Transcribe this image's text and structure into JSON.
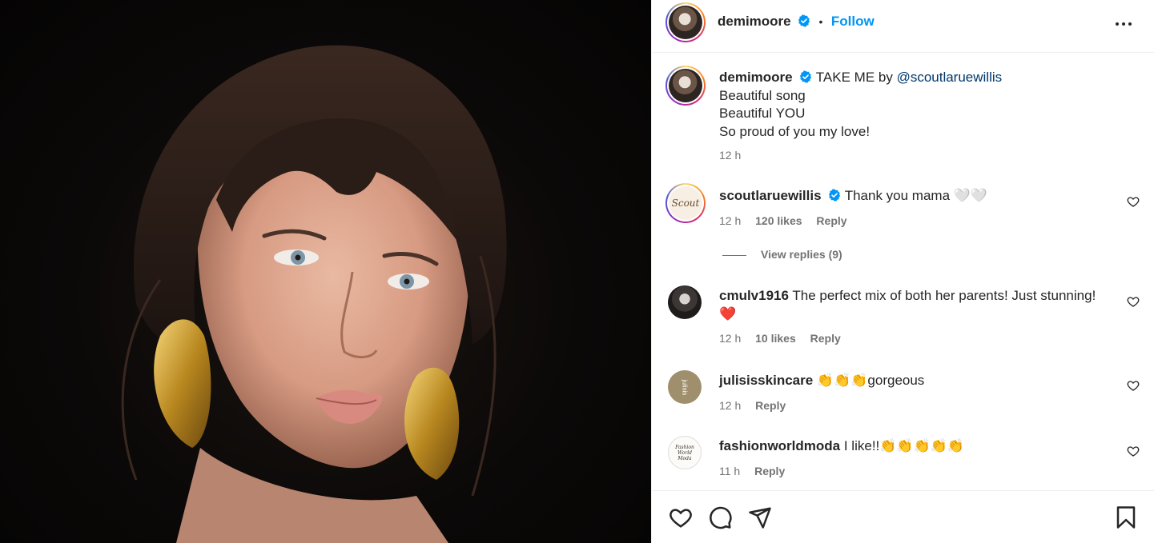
{
  "post": {
    "author": "demimoore",
    "verified": true,
    "follow_label": "Follow",
    "separator": "•"
  },
  "caption": {
    "username": "demimoore",
    "text_prefix": "TAKE ME by ",
    "mention": "@scoutlaruewillis",
    "lines": [
      "Beautiful song",
      "Beautiful YOU",
      "So proud of you my love!"
    ],
    "time": "12 h"
  },
  "comments": [
    {
      "username": "scoutlaruewillis",
      "verified": true,
      "text": "Thank you mama 🤍🤍",
      "time": "12 h",
      "likes": "120 likes",
      "reply_label": "Reply",
      "avatar_text": "Scout"
    },
    {
      "username": "cmulv1916",
      "verified": false,
      "text": "The perfect mix of both her parents! Just stunning!",
      "text_line2": "❤️",
      "time": "12 h",
      "likes": "10 likes",
      "reply_label": "Reply"
    },
    {
      "username": "julisisskincare",
      "verified": false,
      "text": "👏👏👏gorgeous",
      "time": "12 h",
      "reply_label": "Reply",
      "avatar_text": "julisis"
    },
    {
      "username": "fashionworldmoda",
      "verified": false,
      "text": "I like!!👏👏👏👏👏",
      "time": "11 h",
      "reply_label": "Reply",
      "avatar_text": "Fashion World Moda"
    }
  ],
  "view_replies": "View replies (9)",
  "icons": {
    "verified": "verified-badge-icon",
    "more": "more-options-icon",
    "like": "heart-icon",
    "comment": "comment-icon",
    "share": "share-icon",
    "save": "bookmark-icon"
  },
  "colors": {
    "accent": "#0095f6",
    "verified": "#0095f6",
    "mention": "#00376b",
    "muted": "#737373"
  }
}
